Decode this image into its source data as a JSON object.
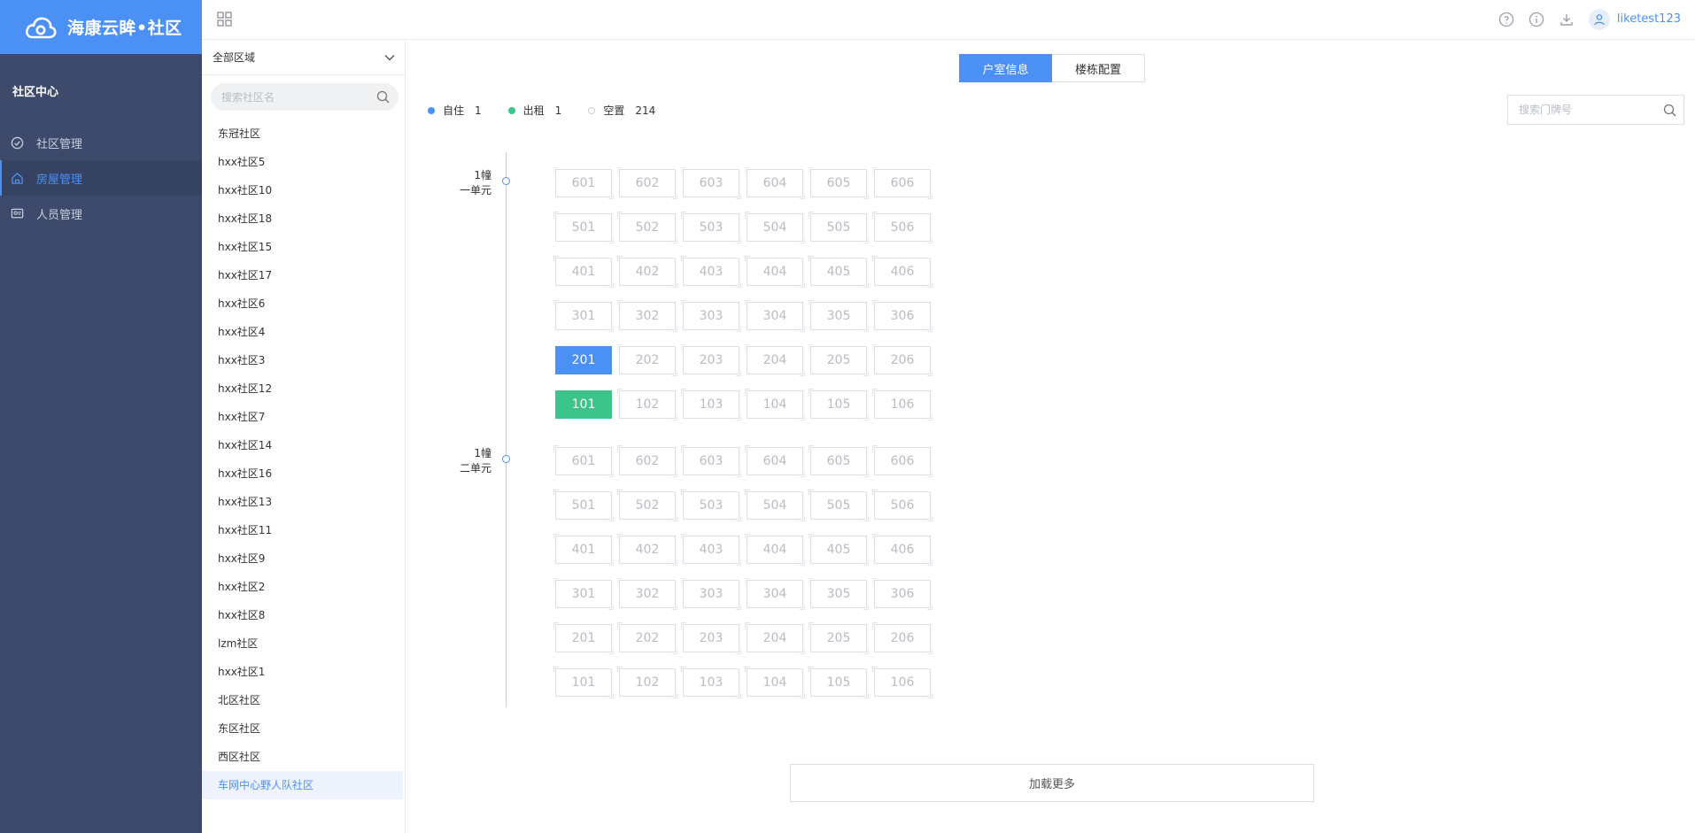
{
  "brand": {
    "name": "海康云眸•社区"
  },
  "sidebar": {
    "section_title": "社区中心",
    "items": [
      {
        "label": "社区管理",
        "icon": "community-icon",
        "active": false
      },
      {
        "label": "房屋管理",
        "icon": "house-icon",
        "active": true
      },
      {
        "label": "人员管理",
        "icon": "person-card-icon",
        "active": false
      }
    ]
  },
  "topbar": {
    "username": "liketest123",
    "icons": [
      "help-icon",
      "info-icon",
      "download-icon",
      "user-avatar-icon"
    ]
  },
  "community_panel": {
    "region_select": "全部区域",
    "search_placeholder": "搜索社区名",
    "communities": [
      "东冠社区",
      "hxx社区5",
      "hxx社区10",
      "hxx社区18",
      "hxx社区15",
      "hxx社区17",
      "hxx社区6",
      "hxx社区4",
      "hxx社区3",
      "hxx社区12",
      "hxx社区7",
      "hxx社区14",
      "hxx社区16",
      "hxx社区13",
      "hxx社区11",
      "hxx社区9",
      "hxx社区2",
      "hxx社区8",
      "lzm社区",
      "hxx社区1",
      "北区社区",
      "东区社区",
      "西区社区",
      "车网中心野人队社区"
    ],
    "selected_community": "车网中心野人队社区"
  },
  "main": {
    "tabs": [
      {
        "label": "户室信息",
        "active": true
      },
      {
        "label": "楼栋配置",
        "active": false
      }
    ],
    "legend": [
      {
        "label": "自住",
        "count": "1",
        "color": "#4a90f5",
        "kind": "self"
      },
      {
        "label": "出租",
        "count": "1",
        "color": "#3cc48a",
        "kind": "rent"
      },
      {
        "label": "空置",
        "count": "214",
        "color": "#ffffff",
        "kind": "empty"
      }
    ],
    "door_search_placeholder": "搜索门牌号",
    "units": [
      {
        "building": "1幢",
        "unit": "一单元",
        "floors": [
          {
            "rooms": [
              {
                "no": "601",
                "status": "empty"
              },
              {
                "no": "602",
                "status": "empty"
              },
              {
                "no": "603",
                "status": "empty"
              },
              {
                "no": "604",
                "status": "empty"
              },
              {
                "no": "605",
                "status": "empty"
              },
              {
                "no": "606",
                "status": "empty"
              }
            ]
          },
          {
            "rooms": [
              {
                "no": "501",
                "status": "empty"
              },
              {
                "no": "502",
                "status": "empty"
              },
              {
                "no": "503",
                "status": "empty"
              },
              {
                "no": "504",
                "status": "empty"
              },
              {
                "no": "505",
                "status": "empty"
              },
              {
                "no": "506",
                "status": "empty"
              }
            ]
          },
          {
            "rooms": [
              {
                "no": "401",
                "status": "empty"
              },
              {
                "no": "402",
                "status": "empty"
              },
              {
                "no": "403",
                "status": "empty"
              },
              {
                "no": "404",
                "status": "empty"
              },
              {
                "no": "405",
                "status": "empty"
              },
              {
                "no": "406",
                "status": "empty"
              }
            ]
          },
          {
            "rooms": [
              {
                "no": "301",
                "status": "empty"
              },
              {
                "no": "302",
                "status": "empty"
              },
              {
                "no": "303",
                "status": "empty"
              },
              {
                "no": "304",
                "status": "empty"
              },
              {
                "no": "305",
                "status": "empty"
              },
              {
                "no": "306",
                "status": "empty"
              }
            ]
          },
          {
            "rooms": [
              {
                "no": "201",
                "status": "self"
              },
              {
                "no": "202",
                "status": "empty"
              },
              {
                "no": "203",
                "status": "empty"
              },
              {
                "no": "204",
                "status": "empty"
              },
              {
                "no": "205",
                "status": "empty"
              },
              {
                "no": "206",
                "status": "empty"
              }
            ]
          },
          {
            "rooms": [
              {
                "no": "101",
                "status": "rent"
              },
              {
                "no": "102",
                "status": "empty"
              },
              {
                "no": "103",
                "status": "empty"
              },
              {
                "no": "104",
                "status": "empty"
              },
              {
                "no": "105",
                "status": "empty"
              },
              {
                "no": "106",
                "status": "empty"
              }
            ]
          }
        ]
      },
      {
        "building": "1幢",
        "unit": "二单元",
        "floors": [
          {
            "rooms": [
              {
                "no": "601",
                "status": "empty"
              },
              {
                "no": "602",
                "status": "empty"
              },
              {
                "no": "603",
                "status": "empty"
              },
              {
                "no": "604",
                "status": "empty"
              },
              {
                "no": "605",
                "status": "empty"
              },
              {
                "no": "606",
                "status": "empty"
              }
            ]
          },
          {
            "rooms": [
              {
                "no": "501",
                "status": "empty"
              },
              {
                "no": "502",
                "status": "empty"
              },
              {
                "no": "503",
                "status": "empty"
              },
              {
                "no": "504",
                "status": "empty"
              },
              {
                "no": "505",
                "status": "empty"
              },
              {
                "no": "506",
                "status": "empty"
              }
            ]
          },
          {
            "rooms": [
              {
                "no": "401",
                "status": "empty"
              },
              {
                "no": "402",
                "status": "empty"
              },
              {
                "no": "403",
                "status": "empty"
              },
              {
                "no": "404",
                "status": "empty"
              },
              {
                "no": "405",
                "status": "empty"
              },
              {
                "no": "406",
                "status": "empty"
              }
            ]
          },
          {
            "rooms": [
              {
                "no": "301",
                "status": "empty"
              },
              {
                "no": "302",
                "status": "empty"
              },
              {
                "no": "303",
                "status": "empty"
              },
              {
                "no": "304",
                "status": "empty"
              },
              {
                "no": "305",
                "status": "empty"
              },
              {
                "no": "306",
                "status": "empty"
              }
            ]
          },
          {
            "rooms": [
              {
                "no": "201",
                "status": "empty"
              },
              {
                "no": "202",
                "status": "empty"
              },
              {
                "no": "203",
                "status": "empty"
              },
              {
                "no": "204",
                "status": "empty"
              },
              {
                "no": "205",
                "status": "empty"
              },
              {
                "no": "206",
                "status": "empty"
              }
            ]
          },
          {
            "rooms": [
              {
                "no": "101",
                "status": "empty"
              },
              {
                "no": "102",
                "status": "empty"
              },
              {
                "no": "103",
                "status": "empty"
              },
              {
                "no": "104",
                "status": "empty"
              },
              {
                "no": "105",
                "status": "empty"
              },
              {
                "no": "106",
                "status": "empty"
              }
            ]
          }
        ]
      }
    ],
    "load_more": "加载更多"
  }
}
